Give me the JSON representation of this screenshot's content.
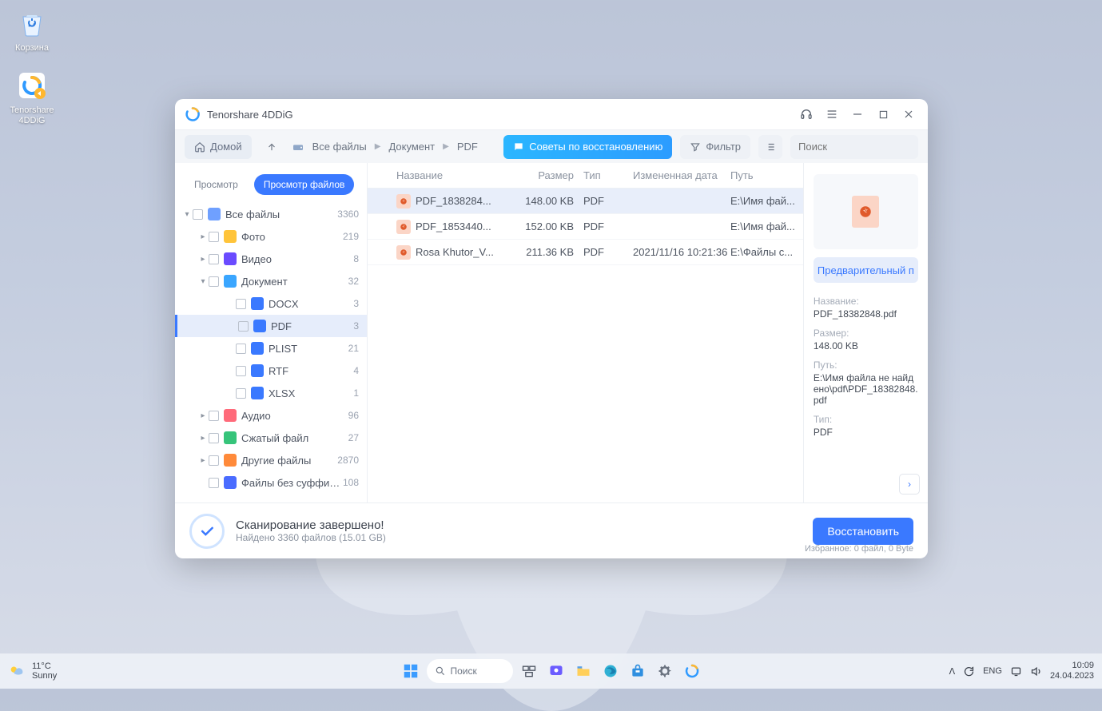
{
  "desktop": {
    "recycle": "Корзина",
    "app": "Tenorshare 4DDiG"
  },
  "window": {
    "title": "Tenorshare 4DDiG",
    "home": "Домой",
    "breadcrumb": [
      "Все файлы",
      "Документ",
      "PDF"
    ],
    "tips": "Советы по восстановлению",
    "filter": "Фильтр",
    "search_ph": "Поиск"
  },
  "tabs": {
    "preview": "Просмотр",
    "files": "Просмотр файлов"
  },
  "tree": [
    {
      "lvl": 0,
      "caret": "▾",
      "icon": "#6fa0ff",
      "label": "Все файлы",
      "count": "3360"
    },
    {
      "lvl": 1,
      "caret": "▸",
      "icon": "#ffc43a",
      "label": "Фото",
      "count": "219"
    },
    {
      "lvl": 1,
      "caret": "▸",
      "icon": "#6a4bff",
      "label": "Видео",
      "count": "8"
    },
    {
      "lvl": 1,
      "caret": "▾",
      "icon": "#3aa6ff",
      "label": "Документ",
      "count": "32"
    },
    {
      "lvl": 2,
      "icon": "#3a79ff",
      "label": "DOCX",
      "count": "3"
    },
    {
      "lvl": 2,
      "icon": "#3a79ff",
      "label": "PDF",
      "count": "3",
      "sel": true
    },
    {
      "lvl": 2,
      "icon": "#3a79ff",
      "label": "PLIST",
      "count": "21"
    },
    {
      "lvl": 2,
      "icon": "#3a79ff",
      "label": "RTF",
      "count": "4"
    },
    {
      "lvl": 2,
      "icon": "#3a79ff",
      "label": "XLSX",
      "count": "1"
    },
    {
      "lvl": 1,
      "caret": "▸",
      "icon": "#ff6a7a",
      "label": "Аудио",
      "count": "96"
    },
    {
      "lvl": 1,
      "caret": "▸",
      "icon": "#36c47a",
      "label": "Сжатый файл",
      "count": "27"
    },
    {
      "lvl": 1,
      "caret": "▸",
      "icon": "#ff8a3a",
      "label": "Другие файлы",
      "count": "2870"
    },
    {
      "lvl": 1,
      "icon": "#4a6cff",
      "label": "Файлы без суффикса",
      "count": "108"
    }
  ],
  "table": {
    "headers": {
      "name": "Название",
      "size": "Размер",
      "type": "Тип",
      "date": "Измененная дата",
      "path": "Путь"
    },
    "rows": [
      {
        "name": "PDF_1838284...",
        "size": "148.00 KB",
        "type": "PDF",
        "date": "",
        "path": "E:\\Имя фай...",
        "sel": true
      },
      {
        "name": "PDF_1853440...",
        "size": "152.00 KB",
        "type": "PDF",
        "date": "",
        "path": "E:\\Имя фай..."
      },
      {
        "name": "Rosa Khutor_V...",
        "size": "211.36 KB",
        "type": "PDF",
        "date": "2021/11/16 10:21:36",
        "path": "E:\\Файлы с..."
      }
    ]
  },
  "panel": {
    "preview_btn": "Предварительный п",
    "name_l": "Название:",
    "name_v": "PDF_18382848.pdf",
    "size_l": "Размер:",
    "size_v": "148.00 KB",
    "path_l": "Путь:",
    "path_v": "E:\\Имя файла не найдено\\pdf\\PDF_18382848.pdf",
    "type_l": "Тип:",
    "type_v": "PDF"
  },
  "footer": {
    "title": "Сканирование завершено!",
    "sub": "Найдено 3360 файлов (15.01 GB)",
    "recover": "Восстановить",
    "selected": "Избранное: 0 файл, 0 Byte"
  },
  "taskbar": {
    "temp": "11°C",
    "cond": "Sunny",
    "search": "Поиск",
    "lang": "ENG",
    "time": "10:09",
    "date": "24.04.2023"
  }
}
